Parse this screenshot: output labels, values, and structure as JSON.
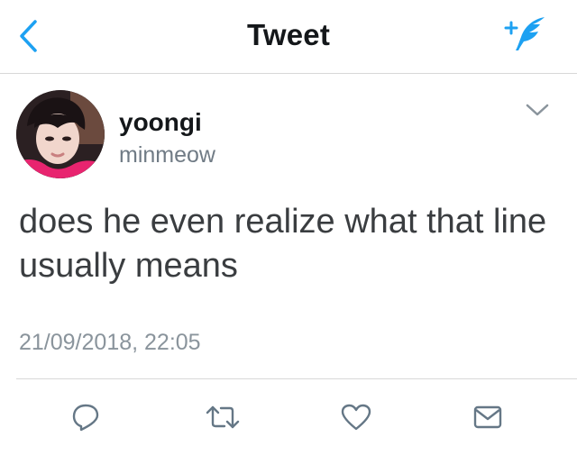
{
  "header": {
    "title": "Tweet",
    "back_icon": "chevron-left-icon",
    "compose_icon": "compose-tweet-icon"
  },
  "tweet": {
    "author": {
      "display_name": "yoongi",
      "handle": "minmeow"
    },
    "text": "does he even realize what that line usually means",
    "timestamp": "21/09/2018, 22:05"
  },
  "actions": [
    {
      "name": "reply",
      "icon": "reply-icon"
    },
    {
      "name": "retweet",
      "icon": "retweet-icon"
    },
    {
      "name": "like",
      "icon": "heart-icon"
    },
    {
      "name": "message",
      "icon": "envelope-icon"
    }
  ],
  "colors": {
    "accent": "#1da1f2",
    "text": "#14171a",
    "secondary": "#707b85",
    "icon_gray": "#657786",
    "divider": "#d8d8d8"
  }
}
